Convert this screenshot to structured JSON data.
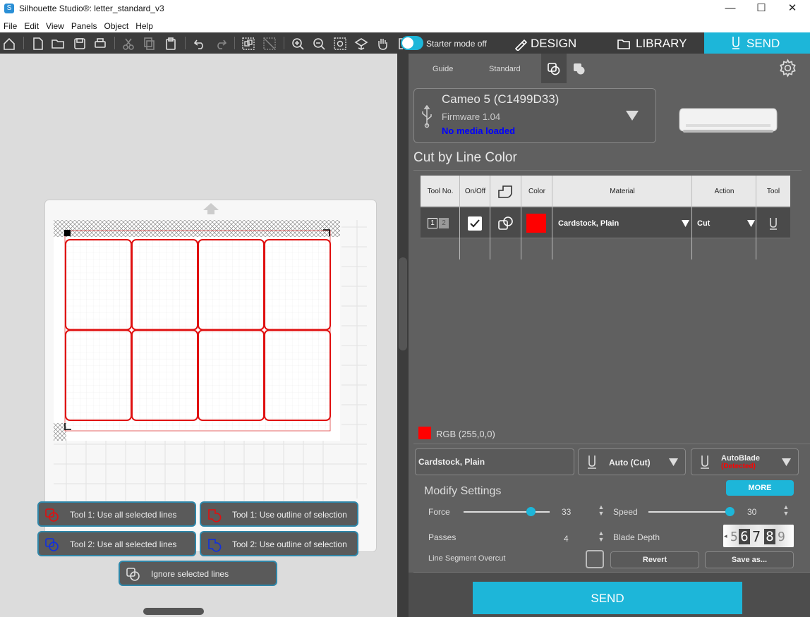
{
  "window": {
    "title": "Silhouette Studio®: letter_standard_v3",
    "minimize": "—",
    "maximize": "☐",
    "close": "✕"
  },
  "menu": [
    "File",
    "Edit",
    "View",
    "Panels",
    "Object",
    "Help"
  ],
  "toolbar": {
    "starter_mode_label": "Starter mode off",
    "tabs": {
      "design": "DESIGN",
      "library": "LIBRARY",
      "send": "SEND"
    }
  },
  "send_panel": {
    "subtabs": {
      "guide": "Guide",
      "standard": "Standard"
    },
    "device": {
      "name": "Cameo 5 (C1499D33)",
      "firmware": "Firmware 1.04",
      "media_status": "No media loaded",
      "media_status_color": "#0000ff"
    },
    "section_title": "Cut by Line Color",
    "table": {
      "headers": [
        "Tool No.",
        "On/Off",
        "",
        "Color",
        "Material",
        "Action",
        "Tool"
      ],
      "rows": [
        {
          "tool_no": [
            "1",
            "2"
          ],
          "on": true,
          "color": "#ff0000",
          "material": "Cardstock, Plain",
          "action": "Cut"
        }
      ]
    },
    "rgb_label": "RGB (255,0,0)",
    "material_select": "Cardstock, Plain",
    "cut_mode_select": "Auto (Cut)",
    "blade": {
      "name": "AutoBlade",
      "status": "(Detected)",
      "status_color": "#ff0000"
    },
    "modify_title": "Modify Settings",
    "more_label": "MORE",
    "settings": {
      "force_label": "Force",
      "force_value": "33",
      "force_fraction": 0.78,
      "speed_label": "Speed",
      "speed_value": "30",
      "speed_fraction": 1.0,
      "passes_label": "Passes",
      "passes_value": "4",
      "blade_depth_label": "Blade Depth",
      "blade_depth_digits": [
        "5",
        "6",
        "7",
        "8",
        "9"
      ],
      "overcut_label": "Line Segment Overcut"
    },
    "revert_label": "Revert",
    "save_as_label": "Save as...",
    "send_label": "SEND"
  },
  "canvas": {
    "float_buttons": {
      "tool1_all": "Tool 1: Use all selected lines",
      "tool1_outline": "Tool 1: Use outline of selection",
      "tool2_all": "Tool 2: Use all selected lines",
      "tool2_outline": "Tool 2: Use outline of selection",
      "ignore": "Ignore selected lines"
    },
    "line_color": "#e01010"
  }
}
